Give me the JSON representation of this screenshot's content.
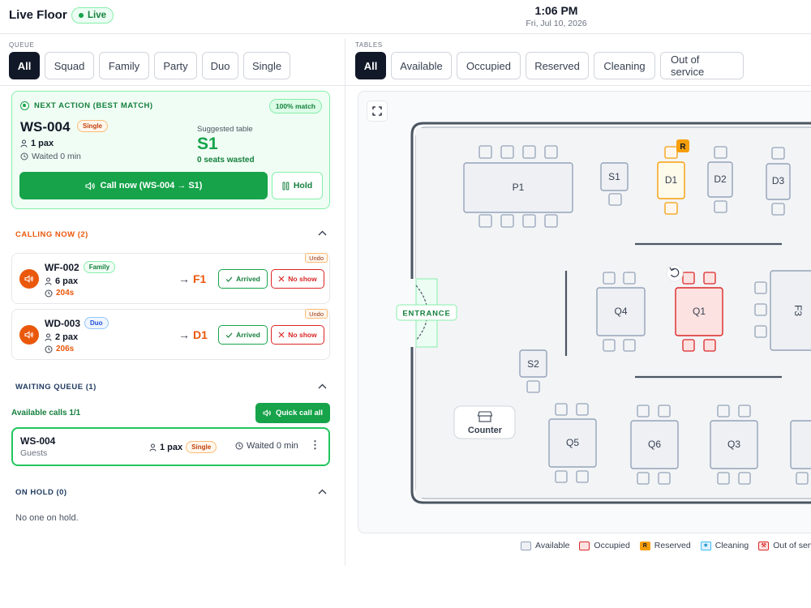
{
  "app": {
    "title": "Live Floor",
    "status": "Live"
  },
  "clock": {
    "time": "1:06 PM",
    "date": "Fri, Jul 10, 2026"
  },
  "queue": {
    "label": "QUEUE",
    "filters": [
      "All",
      "Squad",
      "Family",
      "Party",
      "Duo",
      "Single"
    ],
    "active_filter": "All"
  },
  "tables": {
    "label": "TABLES",
    "filters": [
      "All",
      "Available",
      "Occupied",
      "Reserved",
      "Cleaning",
      "Out of service"
    ],
    "active_filter": "All"
  },
  "next_action": {
    "heading": "NEXT ACTION (BEST MATCH)",
    "match": "100% match",
    "id": "WS-004",
    "type": "Single",
    "pax": "1 pax",
    "waited": "Waited 0 min",
    "suggested_label": "Suggested table",
    "suggested_table": "S1",
    "seats_wasted": "0 seats wasted",
    "call_label": "Call now (WS-004 → S1)",
    "hold_label": "Hold"
  },
  "calling_now": {
    "title": "CALLING NOW (2)",
    "items": [
      {
        "id": "WF-002",
        "type": "Family",
        "pax": "6 pax",
        "time": "204s",
        "table": "F1",
        "undo": "Undo",
        "arrived": "Arrived",
        "no_show": "No show"
      },
      {
        "id": "WD-003",
        "type": "Duo",
        "pax": "2 pax",
        "time": "206s",
        "table": "D1",
        "undo": "Undo",
        "arrived": "Arrived",
        "no_show": "No show"
      }
    ]
  },
  "waiting_queue": {
    "title": "WAITING QUEUE (1)",
    "available_calls": "Available calls 1/1",
    "quick_call": "Quick call all",
    "items": [
      {
        "id": "WS-004",
        "sub": "Guests",
        "pax": "1 pax",
        "type": "Single",
        "waited": "Waited 0 min"
      }
    ]
  },
  "on_hold": {
    "title": "ON HOLD (0)",
    "empty": "No one on hold."
  },
  "floor": {
    "entrance": "ENTRANCE",
    "counter": "Counter",
    "reserved_marker": "R",
    "tables": [
      {
        "name": "P1",
        "status": "available"
      },
      {
        "name": "S1",
        "status": "available"
      },
      {
        "name": "D1",
        "status": "reserved"
      },
      {
        "name": "D2",
        "status": "available"
      },
      {
        "name": "D3",
        "status": "available"
      },
      {
        "name": "Q4",
        "status": "available"
      },
      {
        "name": "Q1",
        "status": "occupied"
      },
      {
        "name": "F3",
        "status": "available"
      },
      {
        "name": "S2",
        "status": "available"
      },
      {
        "name": "Q5",
        "status": "available"
      },
      {
        "name": "Q6",
        "status": "available"
      },
      {
        "name": "Q3",
        "status": "available"
      }
    ]
  },
  "legend": {
    "available": "Available",
    "occupied": "Occupied",
    "reserved": "Reserved",
    "cleaning": "Cleaning",
    "out_of_service": "Out of service",
    "reserved_marker": "R"
  },
  "colors": {
    "green": "#16a34a",
    "orange": "#ea580c",
    "reserved": "#f59e0b",
    "occupied_fill": "#fde2e2",
    "occupied_stroke": "#dc2626",
    "available_fill": "#eef0f4",
    "available_stroke": "#94a3b8"
  }
}
